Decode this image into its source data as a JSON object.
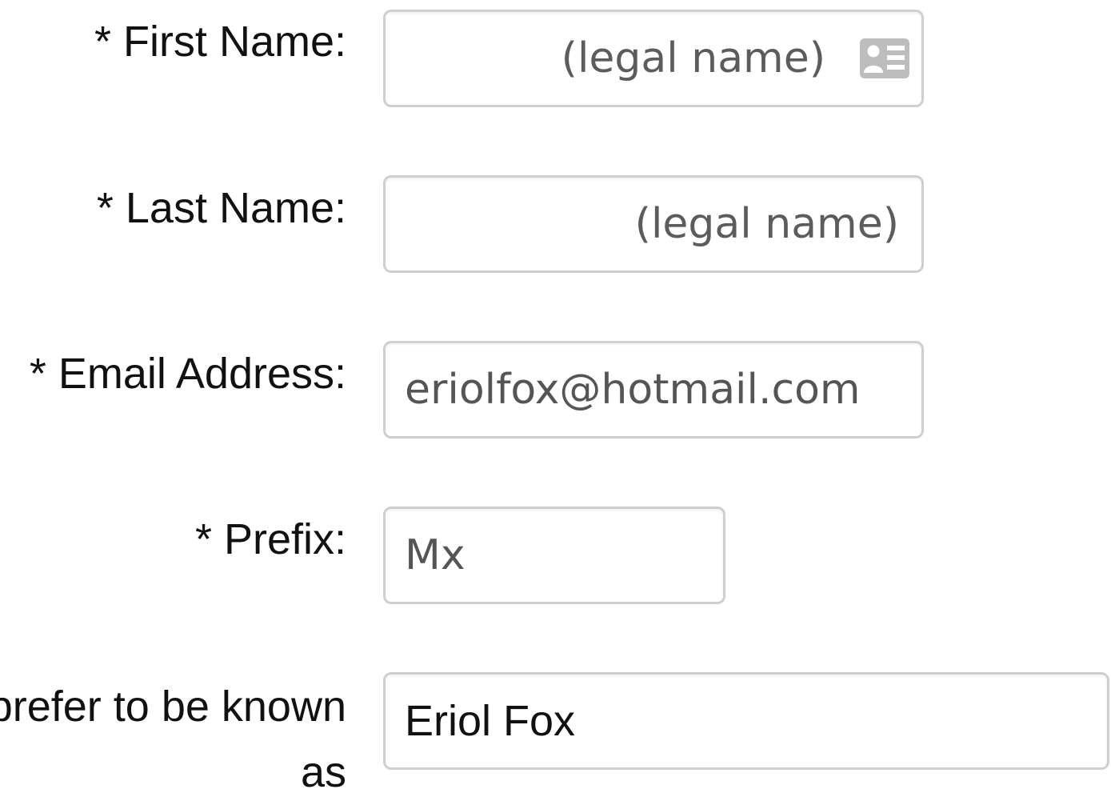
{
  "form": {
    "first_name": {
      "label": "* First Name:",
      "placeholder": "(legal name)",
      "icon": "contact-card-icon"
    },
    "last_name": {
      "label": "* Last Name:",
      "placeholder": "(legal name)"
    },
    "email": {
      "label": "* Email Address:",
      "value": "eriolfox@hotmail.com"
    },
    "prefix": {
      "label": "* Prefix:",
      "value": "Mx"
    },
    "known_as": {
      "label": "I prefer to be known as",
      "value": "Eriol Fox"
    }
  },
  "colors": {
    "field_border": "#cfcfcf",
    "icon": "#bdbdbd"
  }
}
